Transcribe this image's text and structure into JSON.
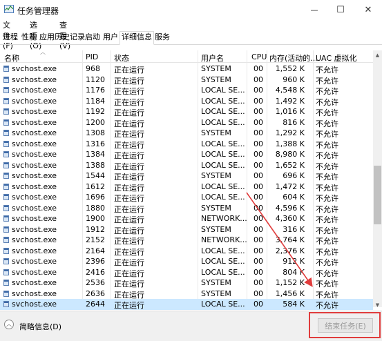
{
  "window": {
    "title": "任务管理器",
    "minimize_glyph": "—",
    "maximize_glyph": "☐",
    "close_glyph": "✕"
  },
  "menu": [
    "文件(F)",
    "选项(O)",
    "查看(V)"
  ],
  "tabs": [
    {
      "label": "进程",
      "active": false
    },
    {
      "label": "性能",
      "active": false
    },
    {
      "label": "应用历史记录",
      "active": false
    },
    {
      "label": "启动",
      "active": false
    },
    {
      "label": "用户",
      "active": false
    },
    {
      "label": "详细信息",
      "active": true
    },
    {
      "label": "服务",
      "active": false
    }
  ],
  "table": {
    "columns": [
      "名称",
      "PID",
      "状态",
      "用户名",
      "CPU",
      "内存(活动的...",
      "UAC 虚拟化"
    ],
    "rows": [
      {
        "name": "svchost.exe",
        "pid": "968",
        "status": "正在运行",
        "user": "SYSTEM",
        "cpu": "00",
        "mem": "1,552 K",
        "uac": "不允许"
      },
      {
        "name": "svchost.exe",
        "pid": "1120",
        "status": "正在运行",
        "user": "SYSTEM",
        "cpu": "00",
        "mem": "960 K",
        "uac": "不允许"
      },
      {
        "name": "svchost.exe",
        "pid": "1176",
        "status": "正在运行",
        "user": "LOCAL SE...",
        "cpu": "00",
        "mem": "4,548 K",
        "uac": "不允许"
      },
      {
        "name": "svchost.exe",
        "pid": "1184",
        "status": "正在运行",
        "user": "LOCAL SE...",
        "cpu": "00",
        "mem": "1,492 K",
        "uac": "不允许"
      },
      {
        "name": "svchost.exe",
        "pid": "1192",
        "status": "正在运行",
        "user": "LOCAL SE...",
        "cpu": "00",
        "mem": "1,016 K",
        "uac": "不允许"
      },
      {
        "name": "svchost.exe",
        "pid": "1200",
        "status": "正在运行",
        "user": "LOCAL SE...",
        "cpu": "00",
        "mem": "816 K",
        "uac": "不允许"
      },
      {
        "name": "svchost.exe",
        "pid": "1308",
        "status": "正在运行",
        "user": "SYSTEM",
        "cpu": "00",
        "mem": "1,292 K",
        "uac": "不允许"
      },
      {
        "name": "svchost.exe",
        "pid": "1316",
        "status": "正在运行",
        "user": "LOCAL SE...",
        "cpu": "00",
        "mem": "1,388 K",
        "uac": "不允许"
      },
      {
        "name": "svchost.exe",
        "pid": "1384",
        "status": "正在运行",
        "user": "LOCAL SE...",
        "cpu": "00",
        "mem": "8,980 K",
        "uac": "不允许"
      },
      {
        "name": "svchost.exe",
        "pid": "1388",
        "status": "正在运行",
        "user": "LOCAL SE...",
        "cpu": "00",
        "mem": "1,652 K",
        "uac": "不允许"
      },
      {
        "name": "svchost.exe",
        "pid": "1544",
        "status": "正在运行",
        "user": "SYSTEM",
        "cpu": "00",
        "mem": "696 K",
        "uac": "不允许"
      },
      {
        "name": "svchost.exe",
        "pid": "1612",
        "status": "正在运行",
        "user": "LOCAL SE...",
        "cpu": "00",
        "mem": "1,472 K",
        "uac": "不允许"
      },
      {
        "name": "svchost.exe",
        "pid": "1696",
        "status": "正在运行",
        "user": "LOCAL SE...",
        "cpu": "00",
        "mem": "604 K",
        "uac": "不允许"
      },
      {
        "name": "svchost.exe",
        "pid": "1880",
        "status": "正在运行",
        "user": "SYSTEM",
        "cpu": "00",
        "mem": "4,596 K",
        "uac": "不允许"
      },
      {
        "name": "svchost.exe",
        "pid": "1900",
        "status": "正在运行",
        "user": "NETWORK...",
        "cpu": "00",
        "mem": "4,360 K",
        "uac": "不允许"
      },
      {
        "name": "svchost.exe",
        "pid": "1912",
        "status": "正在运行",
        "user": "SYSTEM",
        "cpu": "00",
        "mem": "316 K",
        "uac": "不允许"
      },
      {
        "name": "svchost.exe",
        "pid": "2152",
        "status": "正在运行",
        "user": "NETWORK...",
        "cpu": "00",
        "mem": "3,764 K",
        "uac": "不允许"
      },
      {
        "name": "svchost.exe",
        "pid": "2164",
        "status": "正在运行",
        "user": "LOCAL SE...",
        "cpu": "00",
        "mem": "2,376 K",
        "uac": "不允许"
      },
      {
        "name": "svchost.exe",
        "pid": "2396",
        "status": "正在运行",
        "user": "LOCAL SE...",
        "cpu": "00",
        "mem": "912 K",
        "uac": "不允许"
      },
      {
        "name": "svchost.exe",
        "pid": "2416",
        "status": "正在运行",
        "user": "LOCAL SE...",
        "cpu": "00",
        "mem": "804 K",
        "uac": "不允许"
      },
      {
        "name": "svchost.exe",
        "pid": "2536",
        "status": "正在运行",
        "user": "SYSTEM",
        "cpu": "00",
        "mem": "1,152 K",
        "uac": "不允许"
      },
      {
        "name": "svchost.exe",
        "pid": "2636",
        "status": "正在运行",
        "user": "SYSTEM",
        "cpu": "00",
        "mem": "1,456 K",
        "uac": "不允许"
      },
      {
        "name": "svchost.exe",
        "pid": "2644",
        "status": "正在运行",
        "user": "LOCAL SE...",
        "cpu": "00",
        "mem": "584 K",
        "uac": "不允许",
        "selected": true
      }
    ]
  },
  "footer": {
    "brief_label": "简略信息(D)",
    "end_task_label": "结束任务(E)"
  },
  "colors": {
    "selected_row": "#cce8ff",
    "annotation": "#e03c3c"
  }
}
